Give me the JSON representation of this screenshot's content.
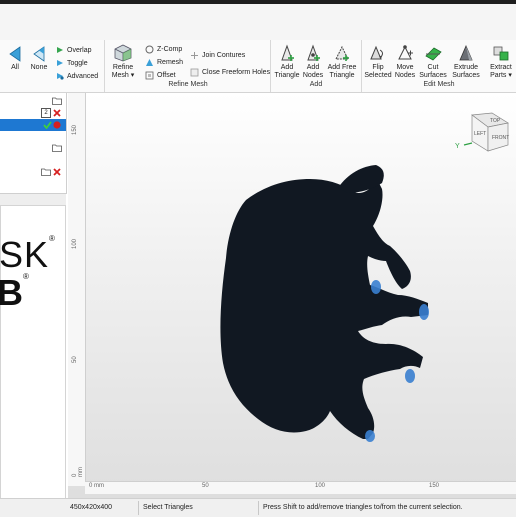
{
  "ribbon": {
    "select": {
      "all_label": "All",
      "none_label": "None",
      "overlap_label": "Overlap",
      "toggle_label": "Toggle",
      "advanced_label": "Advanced"
    },
    "refine": {
      "refine_mesh_label": "Refine Mesh ▾",
      "zcomp_label": "Z-Comp",
      "remesh_label": "Remesh",
      "offset_label": "Offset",
      "join_contours_label": "Join Contures",
      "close_freeform_label": "Close Freeform Holes",
      "group_label": "Refine Mesh"
    },
    "add": {
      "add_triangle_label": "Add Triangle",
      "add_nodes_label": "Add Nodes",
      "add_free_triangle_label": "Add Free Triangle",
      "group_label": "Add"
    },
    "edit": {
      "flip_selected_label": "Flip Selected",
      "move_nodes_label": "Move Nodes",
      "cut_surfaces_label": "Cut Surfaces",
      "extrude_surfaces_label": "Extrude Surfaces",
      "extract_parts_label": "Extract Parts ▾",
      "group_label": "Edit Mesh"
    }
  },
  "left_panel": {
    "badge": "2",
    "logo_line1": "SK",
    "logo_line2": "B",
    "reg_mark": "®"
  },
  "viewport": {
    "vruler_labels": [
      "150",
      "100",
      "50",
      "0 mm"
    ],
    "hruler_labels": [
      "0 mm",
      "50",
      "100",
      "150"
    ],
    "navcube": {
      "top": "TOP",
      "front": "LEFT",
      "right": "FRONT"
    },
    "axis_y": "Y"
  },
  "status": {
    "dimensions": "450x420x400",
    "mode": "Select Triangles",
    "hint": "Press Shift to add/remove triangles to/from the current selection."
  },
  "colors": {
    "accent": "#1e78d2",
    "model": "#111822",
    "model_highlight": "#3a7fd0"
  }
}
